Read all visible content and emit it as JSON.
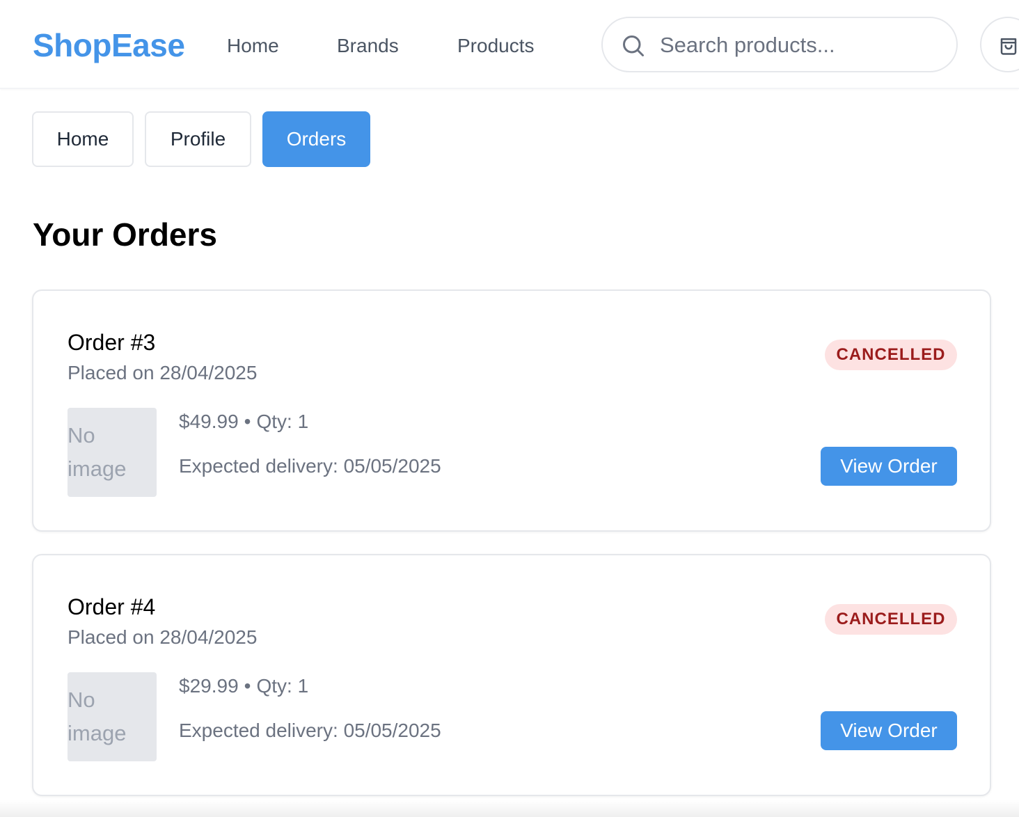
{
  "header": {
    "logo": "ShopEase",
    "nav": [
      "Home",
      "Brands",
      "Products"
    ],
    "search_placeholder": "Search products..."
  },
  "tabs": [
    {
      "label": "Home",
      "active": false
    },
    {
      "label": "Profile",
      "active": false
    },
    {
      "label": "Orders",
      "active": true
    }
  ],
  "page_title": "Your Orders",
  "orders": [
    {
      "title": "Order #3",
      "placed": "Placed on 28/04/2025",
      "status": "CANCELLED",
      "thumb_text": "No image",
      "price": "$49.99",
      "separator": "•",
      "qty": "Qty: 1",
      "delivery": "Expected delivery: 05/05/2025",
      "button": "View Order"
    },
    {
      "title": "Order #4",
      "placed": "Placed on 28/04/2025",
      "status": "CANCELLED",
      "thumb_text": "No image",
      "price": "$29.99",
      "separator": "•",
      "qty": "Qty: 1",
      "delivery": "Expected delivery: 05/05/2025",
      "button": "View Order"
    }
  ],
  "colors": {
    "accent": "#4494e8",
    "badge_bg": "#fde2e2",
    "badge_text": "#9b1c1c"
  },
  "icons": {
    "search": "search-icon",
    "cart": "shopping-bag-icon"
  }
}
